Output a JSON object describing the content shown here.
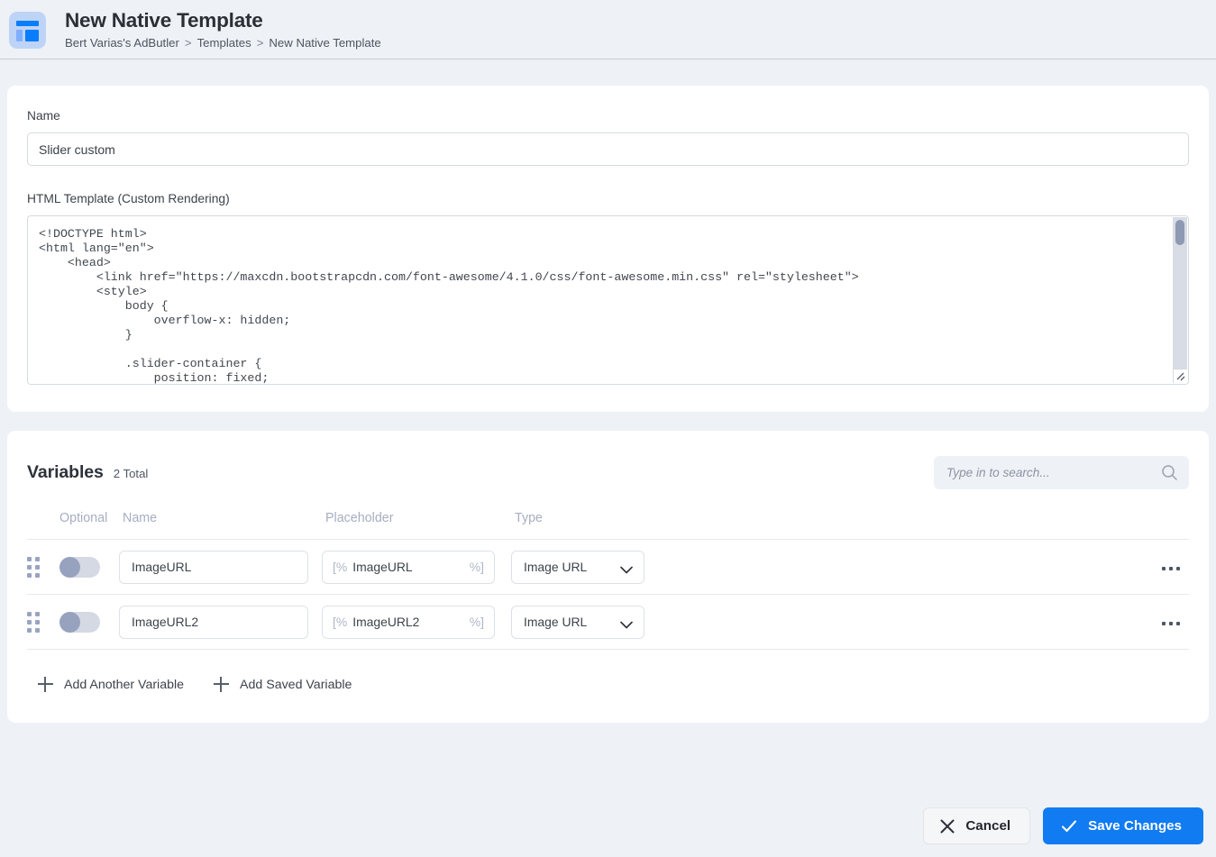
{
  "header": {
    "icon": "template-layout-icon",
    "title": "New Native Template",
    "breadcrumb": [
      {
        "label": "Bert Varias's AdButler"
      },
      {
        "label": "Templates"
      },
      {
        "label": "New Native Template"
      }
    ],
    "separator": ">"
  },
  "form": {
    "name_label": "Name",
    "name_value": "Slider custom",
    "name_placeholder": "",
    "html_label": "HTML Template (Custom Rendering)",
    "html_code": "<!DOCTYPE html>\n<html lang=\"en\">\n    <head>\n        <link href=\"https://maxcdn.bootstrapcdn.com/font-awesome/4.1.0/css/font-awesome.min.css\" rel=\"stylesheet\">\n        <style>\n            body {\n                overflow-x: hidden;\n            }\n\n            .slider-container {\n                position: fixed;"
  },
  "variables": {
    "title": "Variables",
    "count_label": "2 Total",
    "search_placeholder": "Type in to search...",
    "search_value": "",
    "search_icon": "search-icon",
    "columns": {
      "optional": "Optional",
      "name": "Name",
      "placeholder": "Placeholder",
      "type": "Type"
    },
    "rows": [
      {
        "optional": false,
        "name": "ImageURL",
        "placeholder_open": "[%",
        "placeholder_name": "ImageURL",
        "placeholder_close": "%]",
        "type": "Image URL",
        "menu_icon": "kebab-menu-icon",
        "drag_icon": "drag-handle-icon"
      },
      {
        "optional": false,
        "name": "ImageURL2",
        "placeholder_open": "[%",
        "placeholder_name": "ImageURL2",
        "placeholder_close": "%]",
        "type": "Image URL",
        "menu_icon": "kebab-menu-icon",
        "drag_icon": "drag-handle-icon"
      }
    ],
    "add_another_label": "Add Another Variable",
    "add_saved_label": "Add Saved Variable"
  },
  "footer": {
    "cancel_label": "Cancel",
    "save_label": "Save Changes"
  },
  "colors": {
    "page_background": "#eef1f5",
    "card_background": "#ffffff",
    "accent_blue": "#117bf2",
    "icon_blue": "#097dfa",
    "icon_blue_light": "#bed4f7",
    "toggle_knob": "#97a2be",
    "muted_text": "#a7aec0"
  }
}
